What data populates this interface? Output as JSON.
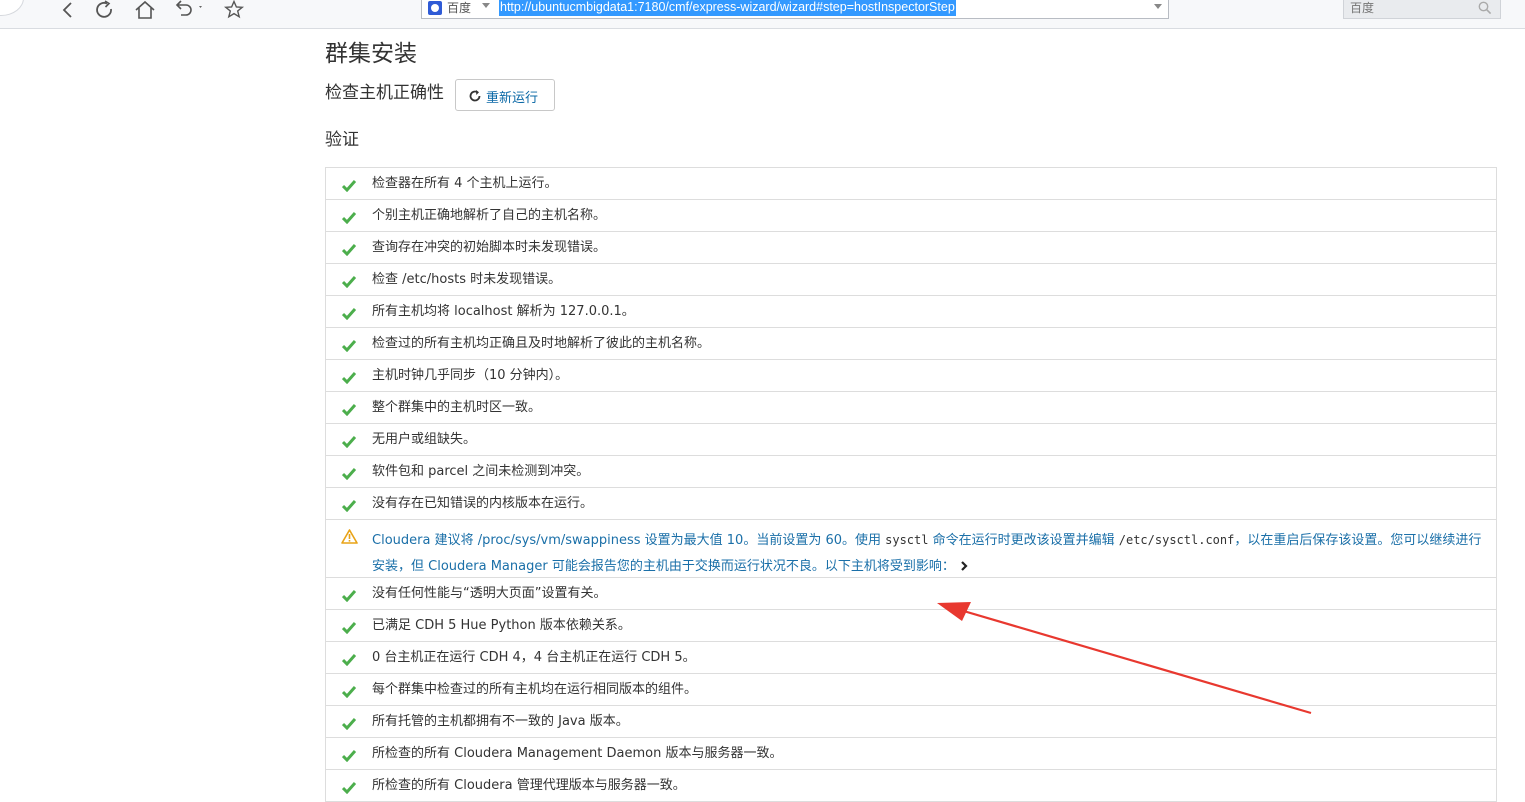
{
  "browser": {
    "search_engine": "百度",
    "url": "http://ubuntucmbigdata1:7180/cmf/express-wizard/wizard#step=hostInspectorStep",
    "search_placeholder": "百度"
  },
  "page": {
    "title": "群集安装",
    "subtitle": "检查主机正确性",
    "rerun_label": "重新运行",
    "section_title": "验证"
  },
  "checks": [
    {
      "status": "ok",
      "text": "检查器在所有 4 个主机上运行。"
    },
    {
      "status": "ok",
      "text": "个别主机正确地解析了自己的主机名称。"
    },
    {
      "status": "ok",
      "text": "查询存在冲突的初始脚本时未发现错误。"
    },
    {
      "status": "ok",
      "text": "检查 /etc/hosts 时未发现错误。"
    },
    {
      "status": "ok",
      "text": "所有主机均将 localhost 解析为 127.0.0.1。"
    },
    {
      "status": "ok",
      "text": "检查过的所有主机均正确且及时地解析了彼此的主机名称。"
    },
    {
      "status": "ok",
      "text": "主机时钟几乎同步（10 分钟内）。"
    },
    {
      "status": "ok",
      "text": "整个群集中的主机时区一致。"
    },
    {
      "status": "ok",
      "text": "无用户或组缺失。"
    },
    {
      "status": "ok",
      "text": "软件包和 parcel 之间未检测到冲突。"
    },
    {
      "status": "ok",
      "text": "没有存在已知错误的内核版本在运行。"
    },
    {
      "status": "warning",
      "text_a": "Cloudera 建议将 /proc/sys/vm/swappiness 设置为最大值 10。当前设置为 60。使用 ",
      "code_a": "sysctl",
      "text_b": " 命令在运行时更改该设置并编辑 ",
      "code_b": "/etc/sysctl.conf",
      "text_c": "，以在重启后保存该设置。您可以继续进行安装，但 Cloudera Manager 可能会报告您的主机由于交换而运行状况不良。以下主机将受到影响："
    },
    {
      "status": "ok",
      "text": "没有任何性能与“透明大页面”设置有关。"
    },
    {
      "status": "ok",
      "text": "已满足 CDH 5 Hue Python 版本依赖关系。"
    },
    {
      "status": "ok",
      "text": "0 台主机正在运行 CDH 4，4 台主机正在运行 CDH 5。"
    },
    {
      "status": "ok",
      "text": "每个群集中检查过的所有主机均在运行相同版本的组件。"
    },
    {
      "status": "ok",
      "text": "所有托管的主机都拥有不一致的 Java 版本。"
    },
    {
      "status": "ok",
      "text": "所检查的所有 Cloudera Management Daemon 版本与服务器一致。"
    },
    {
      "status": "ok",
      "text": "所检查的所有 Cloudera 管理代理版本与服务器一致。"
    }
  ],
  "colors": {
    "check": "#4cae4c",
    "warning": "#e8a317",
    "link": "#1a6fa8",
    "annotation_arrow": "#e8382f"
  }
}
